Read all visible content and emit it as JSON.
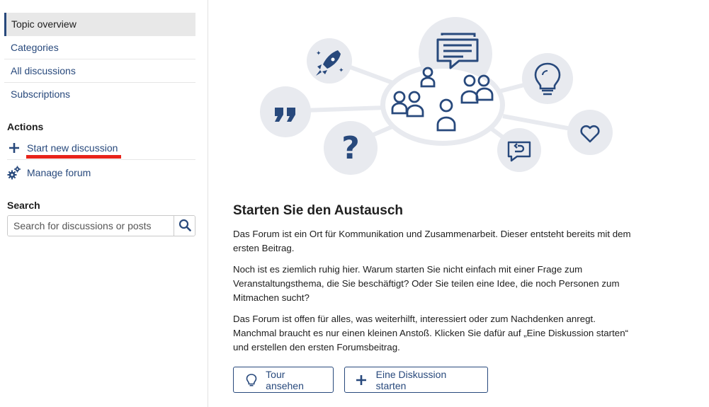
{
  "sidebar": {
    "nav": [
      {
        "label": "Topic overview",
        "active": true
      },
      {
        "label": "Categories",
        "active": false
      },
      {
        "label": "All discussions",
        "active": false
      },
      {
        "label": "Subscriptions",
        "active": false
      }
    ],
    "actions_title": "Actions",
    "actions": {
      "start_label": "Start new discussion",
      "manage_label": "Manage forum"
    },
    "search_title": "Search",
    "search_placeholder": "Search for discussions or posts"
  },
  "main": {
    "heading": "Starten Sie den Austausch",
    "paragraphs": [
      "Das Forum ist ein Ort für Kommunikation und Zusammenarbeit. Dieser entsteht bereits mit dem ersten Beitrag.",
      "Noch ist es ziemlich ruhig hier. Warum starten Sie nicht einfach mit einer Frage zum Veranstaltungsthema, die Sie beschäftigt? Oder Sie teilen eine Idee, die noch Personen zum Mitmachen sucht?",
      "Das Forum ist offen für alles, was weiterhilft, interessiert oder zum Nachdenken anregt. Manchmal braucht es nur einen kleinen Anstoß. Klicken Sie dafür auf „Eine Diskussion starten“ und erstellen den ersten Forumsbeitrag."
    ],
    "buttons": {
      "tour_label": "Tour ansehen",
      "start_label": "Eine Diskussion starten"
    }
  },
  "colors": {
    "accent": "#28497c",
    "highlight": "#e8231a",
    "illustration_circle": "#e8eaef"
  }
}
